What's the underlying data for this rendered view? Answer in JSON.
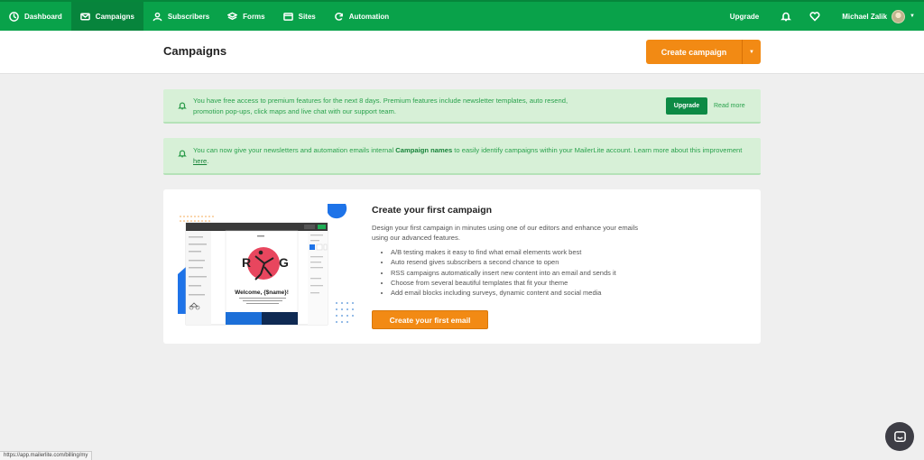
{
  "nav": {
    "items": [
      {
        "label": "Dashboard",
        "icon": "dashboard-icon"
      },
      {
        "label": "Campaigns",
        "icon": "mail-icon"
      },
      {
        "label": "Subscribers",
        "icon": "user-icon"
      },
      {
        "label": "Forms",
        "icon": "layers-icon"
      },
      {
        "label": "Sites",
        "icon": "browser-icon"
      },
      {
        "label": "Automation",
        "icon": "refresh-icon"
      }
    ],
    "upgrade": "Upgrade",
    "user_name": "Michael Zalik"
  },
  "page": {
    "title": "Campaigns",
    "create_button": "Create campaign"
  },
  "notices": [
    {
      "text": "You have free access to premium features for the next 8 days. Premium features include newsletter templates, auto resend, promotion pop-ups, click maps and live chat with our support team.",
      "button": "Upgrade",
      "link": "Read more"
    },
    {
      "text_before": "You can now give your newsletters and automation emails internal ",
      "bold": "Campaign names",
      "text_middle": " to easily identify campaigns within your MailerLite account. Learn more about this improvement ",
      "link": "here",
      "text_after": "."
    }
  ],
  "card": {
    "title": "Create your first campaign",
    "description": "Design your first campaign in minutes using one of our editors and enhance your emails using our advanced features.",
    "features": [
      "A/B testing makes it easy to find what email elements work best",
      "Auto resend gives subscribers a second chance to open",
      "RSS campaigns automatically insert new content into an email and sends it",
      "Choose from several beautiful templates that fit your theme",
      "Add email blocks including surveys, dynamic content and social media"
    ],
    "cta": "Create your first email",
    "preview": {
      "word_left": "R",
      "word_right": "G",
      "welcome": "Welcome, {$name}!"
    }
  },
  "status_url": "https://app.mailerlite.com/billing/my",
  "colors": {
    "brand_green": "#09a24a",
    "accent_orange": "#f28a14",
    "notice_bg": "#d7f0d7"
  }
}
